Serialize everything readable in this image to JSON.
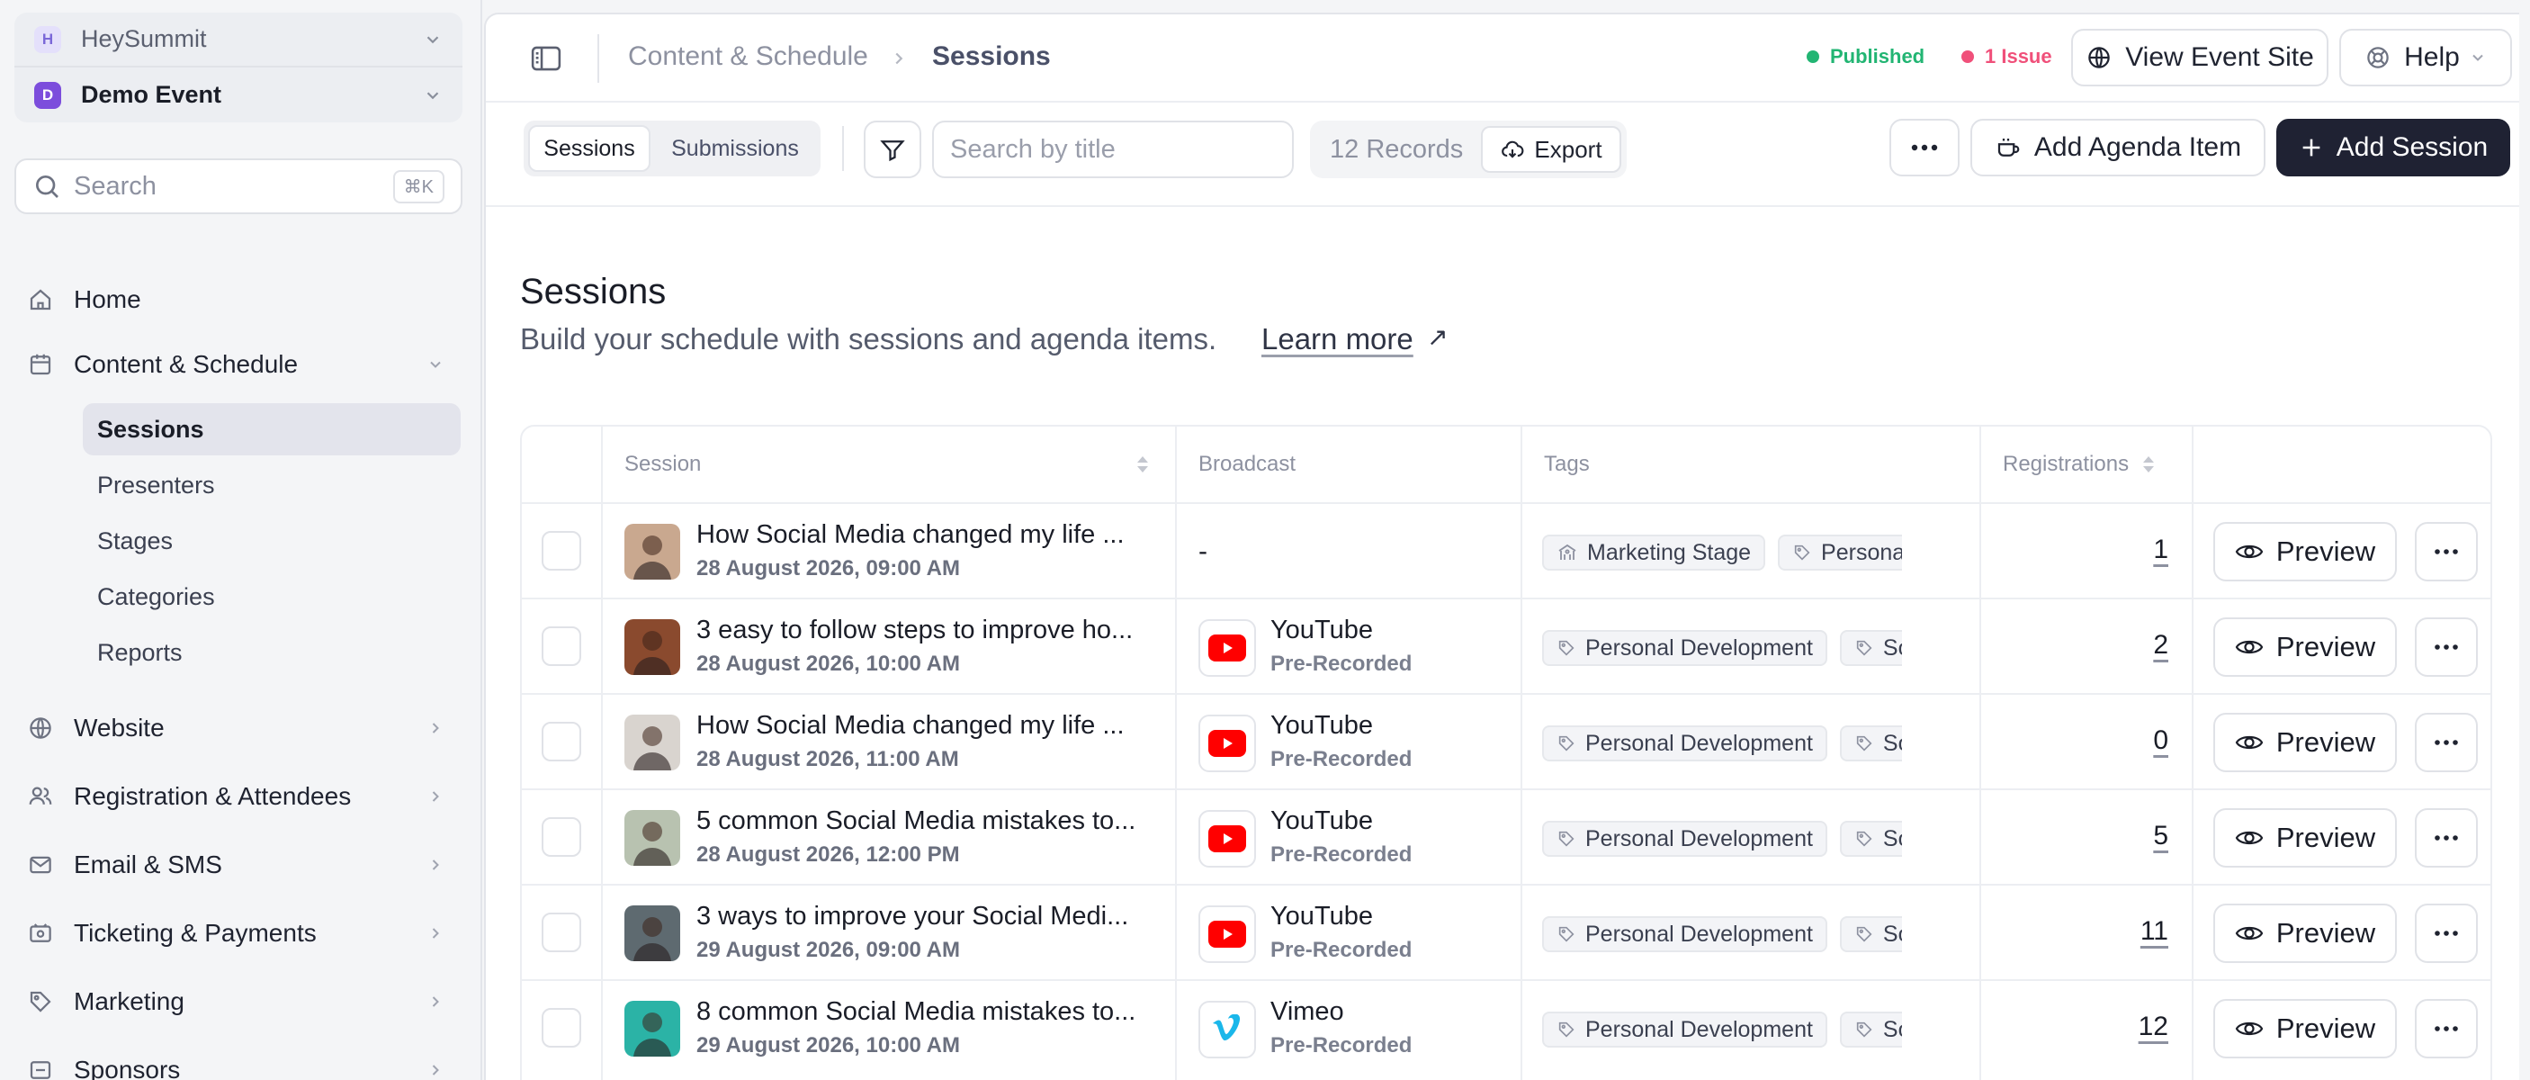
{
  "sidebar": {
    "org": {
      "badge": "H",
      "name": "HeySummit"
    },
    "event": {
      "badge": "D",
      "name": "Demo Event"
    },
    "search": {
      "placeholder": "Search",
      "shortcut": "⌘K"
    },
    "nav": [
      {
        "label": "Home",
        "icon": "home-icon"
      },
      {
        "label": "Content & Schedule",
        "icon": "calendar-icon"
      },
      {
        "label": "Website",
        "icon": "globe-icon"
      },
      {
        "label": "Registration & Attendees",
        "icon": "users-icon"
      },
      {
        "label": "Email & SMS",
        "icon": "mail-icon"
      },
      {
        "label": "Ticketing & Payments",
        "icon": "ticket-icon"
      },
      {
        "label": "Marketing",
        "icon": "tag-icon"
      },
      {
        "label": "Sponsors",
        "icon": "sponsor-icon"
      }
    ],
    "sub_nav": [
      "Sessions",
      "Presenters",
      "Stages",
      "Categories",
      "Reports"
    ]
  },
  "header": {
    "breadcrumb": [
      "Content & Schedule",
      "Sessions"
    ],
    "status_published": "Published",
    "status_issue": "1 Issue",
    "view_site_label": "View Event Site",
    "help_label": "Help"
  },
  "toolbar": {
    "tabs": [
      "Sessions",
      "Submissions"
    ],
    "search_placeholder": "Search by title",
    "records": "12 Records",
    "export_label": "Export",
    "add_agenda_label": "Add Agenda Item",
    "add_session_label": "Add Session"
  },
  "page": {
    "title": "Sessions",
    "subtitle": "Build your schedule with sessions and agenda items.",
    "learn_more": "Learn more",
    "learn_more_icon": "↗"
  },
  "table": {
    "columns": [
      "Session",
      "Broadcast",
      "Tags",
      "Registrations"
    ],
    "preview_label": "Preview",
    "rows": [
      {
        "title": "How Social Media changed my life ...",
        "date": "28 August 2026, 09:00 AM",
        "broadcast": "-",
        "broadcast_sub": "",
        "provider": "none",
        "tags": [
          "Marketing Stage",
          "Personal Development"
        ],
        "registrations": "1",
        "avatar_bg": "#c9a88f"
      },
      {
        "title": "3 easy to follow steps to improve ho...",
        "date": "28 August 2026, 10:00 AM",
        "broadcast": "YouTube",
        "broadcast_sub": "Pre-Recorded",
        "provider": "youtube",
        "tags": [
          "Personal Development",
          "Social Media"
        ],
        "registrations": "2",
        "avatar_bg": "#8a4a2e"
      },
      {
        "title": "How Social Media changed my life ...",
        "date": "28 August 2026, 11:00 AM",
        "broadcast": "YouTube",
        "broadcast_sub": "Pre-Recorded",
        "provider": "youtube",
        "tags": [
          "Personal Development",
          "Social Media"
        ],
        "registrations": "0",
        "avatar_bg": "#d9d4cf"
      },
      {
        "title": "5 common Social Media mistakes to...",
        "date": "28 August 2026, 12:00 PM",
        "broadcast": "YouTube",
        "broadcast_sub": "Pre-Recorded",
        "provider": "youtube",
        "tags": [
          "Personal Development",
          "Social Media"
        ],
        "registrations": "5",
        "avatar_bg": "#b8c2b0"
      },
      {
        "title": "3 ways to improve your Social Medi...",
        "date": "29 August 2026, 09:00 AM",
        "broadcast": "YouTube",
        "broadcast_sub": "Pre-Recorded",
        "provider": "youtube",
        "tags": [
          "Personal Development",
          "Social Media"
        ],
        "registrations": "11",
        "avatar_bg": "#5e6a70"
      },
      {
        "title": "8 common Social Media mistakes to...",
        "date": "29 August 2026, 10:00 AM",
        "broadcast": "Vimeo",
        "broadcast_sub": "Pre-Recorded",
        "provider": "vimeo",
        "tags": [
          "Personal Development",
          "Social Media"
        ],
        "registrations": "12",
        "avatar_bg": "#2bb3a6"
      }
    ]
  },
  "colors": {
    "published": "#22b573",
    "issue": "#f0507a",
    "primary_dark": "#1f2233",
    "youtube": "#ff0000",
    "vimeo": "#1ab7ea"
  }
}
